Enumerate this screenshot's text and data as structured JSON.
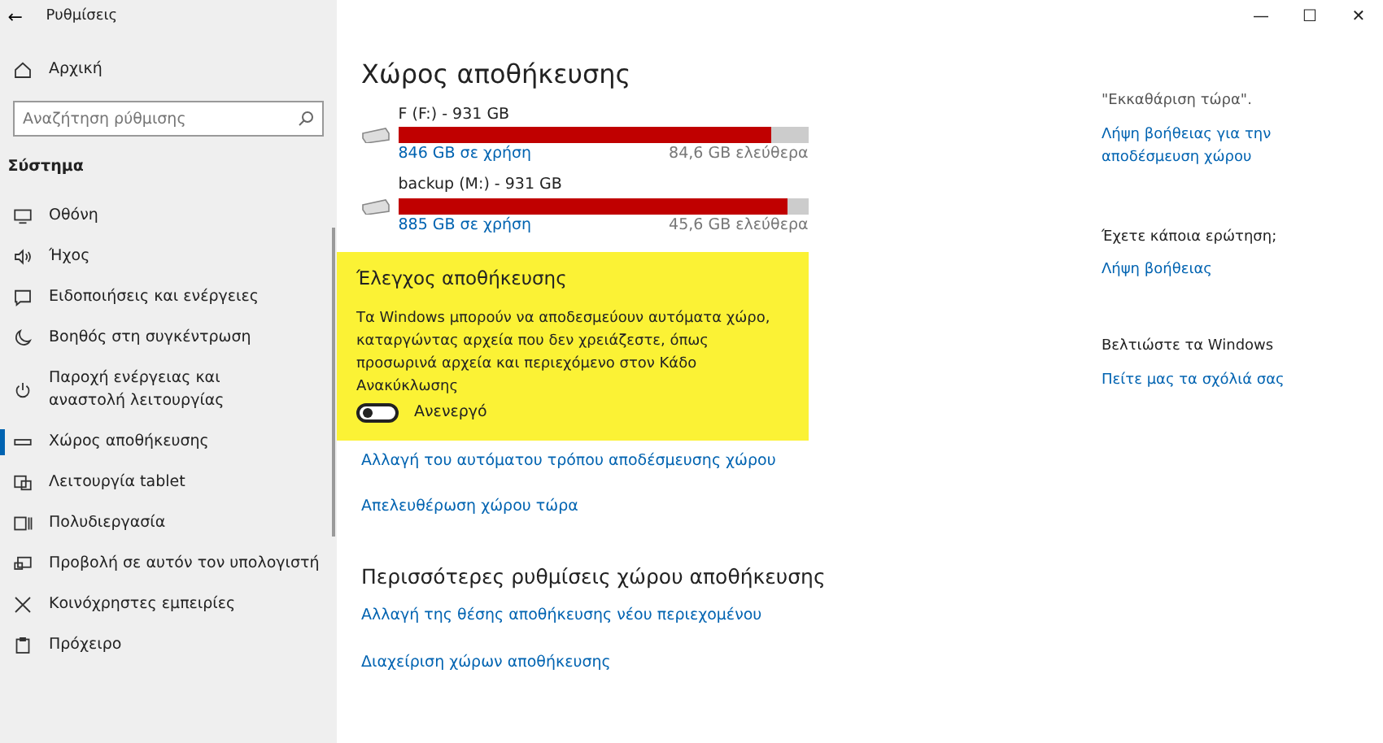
{
  "window": {
    "title": "Ρυθμίσεις",
    "back": "←",
    "controls": [
      "—",
      "☐",
      "✕"
    ]
  },
  "sidebar": {
    "home": "Αρχική",
    "search": {
      "placeholder": "Αναζήτηση ρύθμισης"
    },
    "section": "Σύστημα",
    "items": [
      {
        "label": "Οθόνη",
        "selected": false
      },
      {
        "label": "Ήχος",
        "selected": false
      },
      {
        "label": "Ειδοποιήσεις και ενέργειες",
        "selected": false
      },
      {
        "label": "Βοηθός στη συγκέντρωση",
        "selected": false
      },
      {
        "label": "Παροχή ενέργειας και αναστολή λειτουργίας",
        "selected": false
      },
      {
        "label": "Χώρος αποθήκευσης",
        "selected": true
      },
      {
        "label": "Λειτουργία tablet",
        "selected": false
      },
      {
        "label": "Πολυδιεργασία",
        "selected": false
      },
      {
        "label": "Προβολή σε αυτόν τον υπολογιστή",
        "selected": false
      },
      {
        "label": "Κοινόχρηστες εμπειρίες",
        "selected": false
      },
      {
        "label": "Πρόχειρο",
        "selected": false
      }
    ]
  },
  "main": {
    "title": "Χώρος αποθήκευσης",
    "drives": [
      {
        "name": "F (F:) - 931 GB",
        "level": 0.909,
        "used": "846 GB σε χρήση",
        "free": "84,6 GB ελεύθερα"
      },
      {
        "name": "backup (M:) - 931 GB",
        "level": 0.951,
        "used": "885 GB σε χρήση",
        "free": "45,6 GB ελεύθερα"
      }
    ],
    "storage_sense": {
      "title": "Έλεγχος αποθήκευσης",
      "description": "Τα Windows μπορούν να αποδεσμεύουν αυτόματα χώρο, καταργώντας αρχεία που δεν χρειάζεστε, όπως προσωρινά αρχεία και περιεχόμενο στον Κάδο Ανακύκλωσης",
      "toggle": {
        "on": false,
        "label": "Ανενεργό"
      }
    },
    "links": [
      "Αλλαγή του αυτόματου τρόπου αποδέσμευσης χώρου",
      "Απελευθέρωση χώρου τώρα"
    ],
    "more_title": "Περισσότερες ρυθμίσεις χώρου αποθήκευσης",
    "more_links": [
      "Αλλαγή της θέσης αποθήκευσης νέου περιεχομένου",
      "Διαχείριση χώρων αποθήκευσης"
    ]
  },
  "aside": {
    "groups": [
      {
        "text": "\"Εκκαθάριση τώρα\".",
        "link": "Λήψη βοήθειας για την αποδέσμευση χώρου"
      },
      {
        "text": "Έχετε κάποια ερώτηση;",
        "link": "Λήψη βοήθειας"
      },
      {
        "text": "Βελτιώστε τα Windows",
        "link": "Πείτε μας τα σχόλιά σας"
      }
    ]
  }
}
